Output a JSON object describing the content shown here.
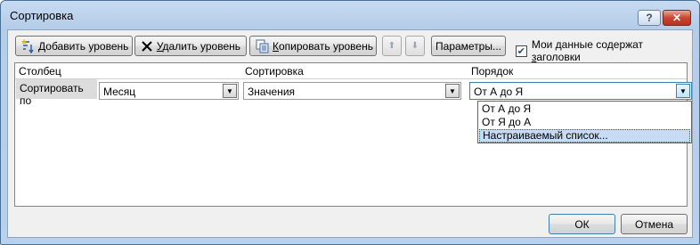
{
  "window": {
    "title": "Сортировка"
  },
  "titlebar": {
    "help": "?",
    "close": "✕"
  },
  "toolbar": {
    "add": {
      "pre": "",
      "key": "Д",
      "post": "обавить уровень"
    },
    "delete": {
      "pre": "",
      "key": "У",
      "post": "далить уровень"
    },
    "copy": {
      "pre": "",
      "key": "К",
      "post": "опировать уровень"
    },
    "params": {
      "pre": "Параметры",
      "key": "",
      "post": "..."
    },
    "move_up": "⬆",
    "move_down": "⬇",
    "headers_checkbox": {
      "checked": true,
      "label_pre": "Мои данные содержат ",
      "label_key": "з",
      "label_post": "аголовки"
    }
  },
  "grid": {
    "headers": {
      "column": "Столбец",
      "sort": "Сортировка",
      "order": "Порядок"
    },
    "row": {
      "label": "Сортировать по",
      "column_value": "Месяц",
      "sort_value": "Значения",
      "order_value": "От А до Я"
    }
  },
  "order_dropdown": {
    "open": true,
    "options": [
      "От А до Я",
      "От Я до А",
      "Настраиваемый список..."
    ],
    "highlighted_index": 2
  },
  "footer": {
    "ok": "ОК",
    "cancel": "Отмена"
  }
}
